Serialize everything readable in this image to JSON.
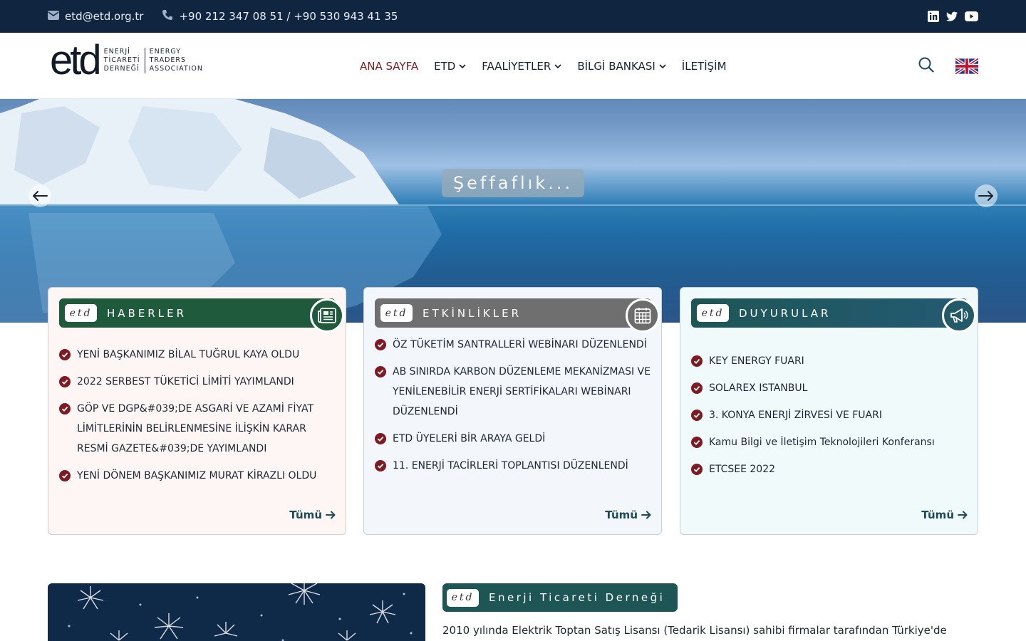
{
  "topbar": {
    "email": "etd@etd.org.tr",
    "phone": "+90 212 347 08 51 / +90 530 943 41 35",
    "social": [
      "linkedin-icon",
      "twitter-icon",
      "youtube-icon"
    ]
  },
  "header": {
    "logo": {
      "mark": "etd",
      "tr_lines": [
        "ENERJİ",
        "TİCARETİ",
        "DERNEĞİ"
      ],
      "en_lines": [
        "ENERGY",
        "TRADERS",
        "ASSOCIATION"
      ]
    },
    "nav": [
      {
        "label": "ANA SAYFA",
        "active": true,
        "dropdown": false
      },
      {
        "label": "ETD",
        "active": false,
        "dropdown": true
      },
      {
        "label": "FAALİYETLER",
        "active": false,
        "dropdown": true
      },
      {
        "label": "BİLGİ BANKASI",
        "active": false,
        "dropdown": true
      },
      {
        "label": "İLETİŞİM",
        "active": false,
        "dropdown": false
      }
    ]
  },
  "hero": {
    "tagline": "Şeffaflık..."
  },
  "cards": {
    "news": {
      "pill": "etd",
      "title": "HABERLER",
      "items": [
        "YENİ BAŞKANIMIZ BİLAL TUĞRUL KAYA OLDU",
        "2022 SERBEST TÜKETİCİ LİMİTİ YAYIMLANDI",
        "GÖP VE DGP&#039;DE ASGARİ VE AZAMİ FİYAT LİMİTLERİNİN BELİRLENMESİNE İLİŞKİN KARAR RESMİ GAZETE&#039;DE YAYIMLANDI",
        "YENİ DÖNEM BAŞKANIMIZ MURAT KİRAZLI OLDU"
      ],
      "more": "Tümü"
    },
    "events": {
      "pill": "etd",
      "title": "ETKİNLİKLER",
      "items": [
        "ÖZ TÜKETİM SANTRALLERİ WEBİNARI DÜZENLENDİ",
        "AB SINIRDA KARBON DÜZENLEME MEKANİZMASI VE YENİLENEBİLİR ENERJİ SERTİFİKALARI WEBİNARI DÜZENLENDİ",
        "ETD ÜYELERİ BİR ARAYA GELDİ",
        "11. ENERJİ TACİRLERİ TOPLANTISI DÜZENLENDİ"
      ],
      "more": "Tümü"
    },
    "announcements": {
      "pill": "etd",
      "title": "DUYURULAR",
      "items": [
        "KEY ENERGY FUARI",
        "SOLAREX ISTANBUL",
        "3. KONYA ENERJİ ZİRVESİ VE FUARI",
        "Kamu Bilgi ve İletişim Teknolojileri Konferansı",
        "ETCSEE 2022"
      ],
      "more": "Tümü"
    }
  },
  "about": {
    "pill": "etd",
    "title": "Enerji Ticareti Derneği",
    "text": "2010 yılında Elektrik Toptan Satış Lisansı (Tedarik Lisansı) sahibi firmalar tarafından Türkiye'de"
  },
  "colors": {
    "topbar": "#0f2540",
    "nav_active": "#7d1a22",
    "news_header": "#1e5a3b",
    "events_header": "#6f6f6f",
    "announcements_header": "#1e5656",
    "check_icon": "#7d1a22"
  }
}
